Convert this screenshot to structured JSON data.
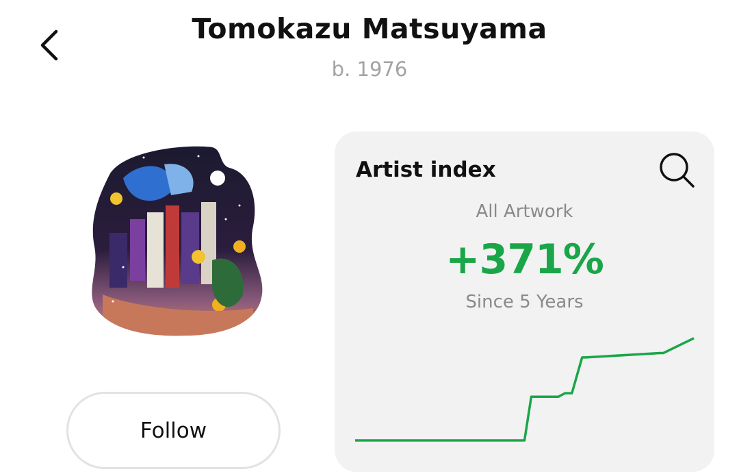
{
  "header": {
    "title": "Tomokazu Matsuyama",
    "subtitle": "b. 1976"
  },
  "icons": {
    "back": "chevron-left-icon",
    "search": "magnifier-icon"
  },
  "artwork": {
    "description_icon": "artwork-thumbnail"
  },
  "actions": {
    "follow_label": "Follow"
  },
  "index_card": {
    "title": "Artist index",
    "filter_label": "All Artwork",
    "change_value": "+371%",
    "period_label": "Since 5 Years",
    "accent_color": "#1aa648",
    "background_color": "#f2f2f2"
  },
  "chart_data": {
    "type": "line",
    "title": "",
    "xlabel": "",
    "ylabel": "",
    "grid": false,
    "legend": "none",
    "x": [
      0,
      0.5,
      0.52,
      0.6,
      0.62,
      0.64,
      0.67,
      0.68,
      0.9,
      0.91,
      1.0
    ],
    "series": [
      {
        "values": [
          0,
          0,
          0.5,
          0.5,
          0.54,
          0.54,
          0.95,
          0.95,
          1.0,
          1.0,
          1.17
        ]
      }
    ],
    "ylim": [
      0,
      1.2
    ]
  }
}
